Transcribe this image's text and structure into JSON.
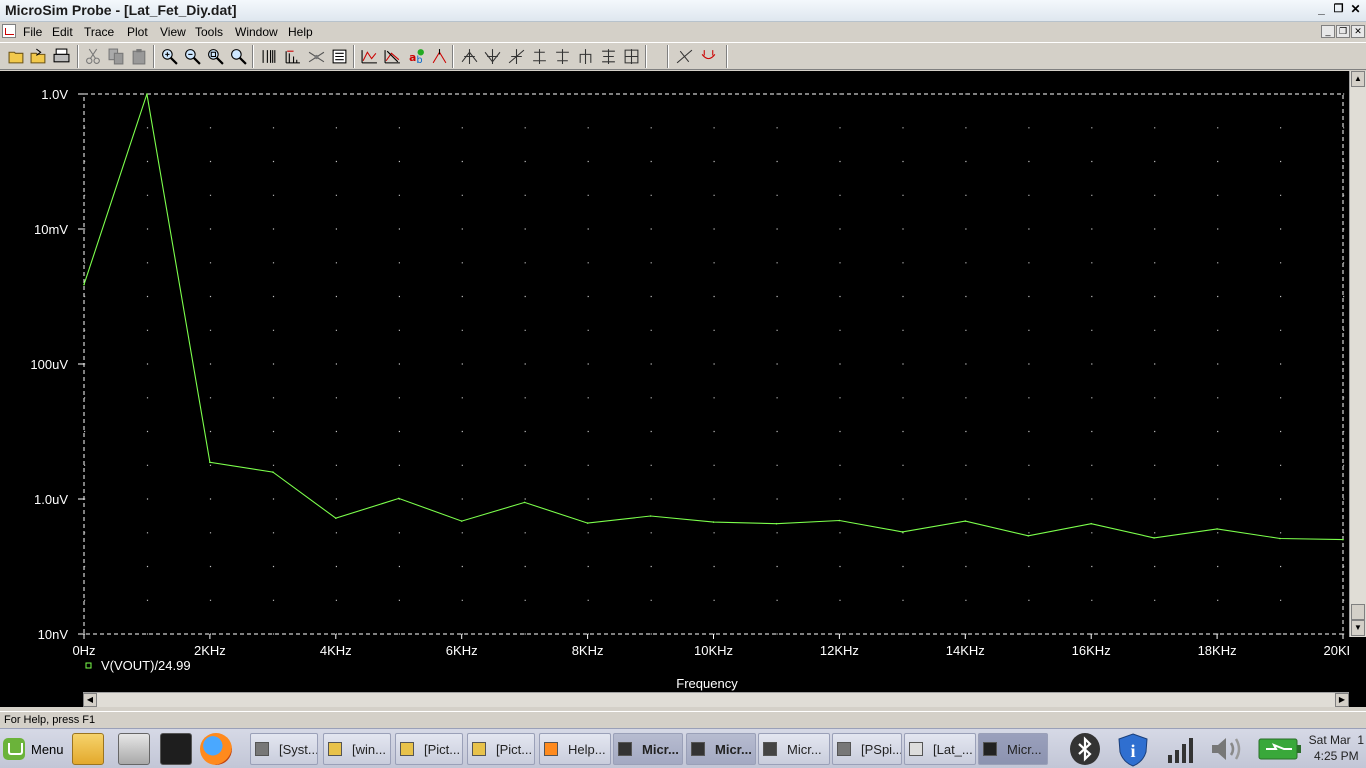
{
  "window": {
    "title": "MicroSim Probe - [Lat_Fet_Diy.dat]",
    "minimize": "_",
    "restore": "❐",
    "close": "✕"
  },
  "menu": [
    "File",
    "Edit",
    "Trace",
    "Plot",
    "View",
    "Tools",
    "Window",
    "Help"
  ],
  "toolbar_icons": [
    "open-icon",
    "open-file-icon",
    "print-icon",
    "cut-icon",
    "copy-icon",
    "paste-icon",
    "zoom-in-icon",
    "zoom-out-icon",
    "zoom-area-icon",
    "zoom-fit-icon",
    "log-x-icon",
    "fourier-icon",
    "performance-icon",
    "eval-icon",
    "add-trace-icon",
    "remove-trace-icon",
    "mark-data-icon",
    "mark-label-icon",
    "cursor-peak-icon",
    "cursor-trough-icon",
    "cursor-slope-icon",
    "cursor-min-icon",
    "cursor-max-icon",
    "cursor-point-icon",
    "cursor-search-icon",
    "cursor-next-icon",
    "mark-label-2-icon",
    "toggle-cursor-icon"
  ],
  "chart_data": {
    "type": "line",
    "x": [
      0,
      1000,
      2000,
      3000,
      4000,
      5000,
      6000,
      7000,
      8000,
      9000,
      10000,
      11000,
      12000,
      13000,
      14000,
      15000,
      16000,
      17000,
      18000,
      19000,
      20000
    ],
    "series": [
      {
        "name": "V(VOUT)/24.99",
        "color": "#7cff4c",
        "values": [
          0.0015,
          1.0,
          3.5e-06,
          2.5e-06,
          5.2e-07,
          1.02e-06,
          4.7e-07,
          8.9e-07,
          4.4e-07,
          5.6e-07,
          4.55e-07,
          4.3e-07,
          4.8e-07,
          3.25e-07,
          4.7e-07,
          2.85e-07,
          4.3e-07,
          2.65e-07,
          3.6e-07,
          2.6e-07,
          2.5e-07
        ]
      }
    ],
    "xlabel": "Frequency",
    "ylabel": "",
    "xlim": [
      0,
      20000
    ],
    "ylim": [
      1e-08,
      1
    ],
    "yscale": "log",
    "x_ticks": [
      0,
      2000,
      4000,
      6000,
      8000,
      10000,
      12000,
      14000,
      16000,
      18000,
      20000
    ],
    "x_tick_labels": [
      "0Hz",
      "2KHz",
      "4KHz",
      "6KHz",
      "8KHz",
      "10KHz",
      "12KHz",
      "14KHz",
      "16KHz",
      "18KHz",
      "20KHz"
    ],
    "y_ticks": [
      1,
      0.01,
      0.0001,
      1e-06,
      1e-08
    ],
    "y_tick_labels": [
      "1.0V",
      "10mV",
      "100uV",
      "1.0uV",
      "10nV"
    ],
    "grid": true,
    "background": "#000000",
    "axis_color": "#ffffff",
    "legend_position": "bottom-left"
  },
  "status": {
    "text": "For Help, press F1"
  },
  "taskbar": {
    "menu_label": "Menu",
    "tasks": [
      {
        "label": "[Syst...",
        "state": "normal"
      },
      {
        "label": "[win...",
        "state": "normal"
      },
      {
        "label": "[Pict...",
        "state": "normal"
      },
      {
        "label": "[Pict...",
        "state": "normal"
      },
      {
        "label": "Help...",
        "state": "normal"
      },
      {
        "label": "Micr...",
        "state": "active"
      },
      {
        "label": "Micr...",
        "state": "active"
      },
      {
        "label": "Micr...",
        "state": "normal"
      },
      {
        "label": "[PSpi...",
        "state": "normal"
      },
      {
        "label": "[Lat_...",
        "state": "normal"
      },
      {
        "label": "Micr...",
        "state": "current"
      }
    ],
    "clock_date": "Sat Mar  1",
    "clock_time": "4:25 PM"
  }
}
